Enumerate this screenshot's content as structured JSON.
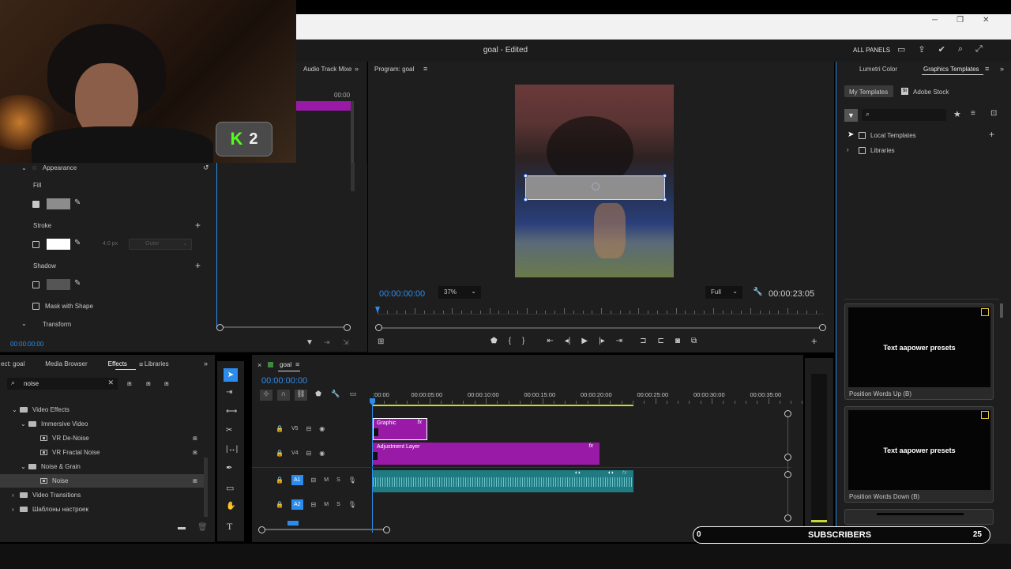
{
  "window": {
    "title": "goal - Edited",
    "all_panels": "ALL PANELS"
  },
  "overlay": {
    "kick_label": "2",
    "sub_left": "0",
    "sub_label": "SUBSCRIBERS",
    "sub_right": "25"
  },
  "effect_controls": {
    "audio_mixer_tab": "Audio Track Mixe",
    "mini_time": "00:00",
    "appearance": "Appearance",
    "fill": "Fill",
    "stroke": "Stroke",
    "stroke_size": "4.0",
    "stroke_unit": "px",
    "stroke_type": "Outer",
    "shadow": "Shadow",
    "mask": "Mask with Shape",
    "transform": "Transform",
    "timecode": "00:00:00:00"
  },
  "program": {
    "tab": "Program: goal",
    "timecode": "00:00:00:00",
    "zoom": "37%",
    "quality": "Full",
    "duration": "00:00:23:05"
  },
  "right_panel": {
    "tab_lumetri": "Lumetri Color",
    "tab_graphics": "Graphics Templates",
    "my_templates": "My Templates",
    "adobe_stock": "Adobe Stock",
    "tree": [
      "Local Templates",
      "Libraries"
    ],
    "templates": [
      {
        "preview": "Text aapower presets",
        "name": "Position Words Up (B)"
      },
      {
        "preview": "Text aapower presets",
        "name": "Position Words Down (B)"
      }
    ]
  },
  "effects_panel": {
    "tabs": [
      "ect: goal",
      "Media Browser",
      "Effects",
      "Libraries"
    ],
    "search_value": "noise",
    "tree": [
      {
        "label": "Video Effects",
        "level": 1,
        "kind": "folder",
        "open": true
      },
      {
        "label": "Immersive Video",
        "level": 2,
        "kind": "folder",
        "open": true
      },
      {
        "label": "VR De-Noise",
        "level": 3,
        "kind": "effect"
      },
      {
        "label": "VR Fractal Noise",
        "level": 3,
        "kind": "effect"
      },
      {
        "label": "Noise & Grain",
        "level": 2,
        "kind": "folder",
        "open": true
      },
      {
        "label": "Noise",
        "level": 3,
        "kind": "effect",
        "selected": true
      },
      {
        "label": "Video Transitions",
        "level": 1,
        "kind": "folder",
        "open": false
      },
      {
        "label": "Шаблоны настроек",
        "level": 1,
        "kind": "folder",
        "open": false
      }
    ]
  },
  "timeline": {
    "sequence": "goal",
    "timecode": "00:00:00:00",
    "ruler": [
      ":00:00",
      "00:00:05:00",
      "00:00:10:00",
      "00:00:15:00",
      "00:00:20:00",
      "00:00:25:00",
      "00:00:30:00",
      "00:00:35:00"
    ],
    "tracks": [
      {
        "id": "V5",
        "clip": "Graphic"
      },
      {
        "id": "V4",
        "clip": "Adjustment Layer"
      },
      {
        "id": "A1",
        "clip": ""
      },
      {
        "id": "A2",
        "clip": ""
      }
    ],
    "fx": "fx",
    "m": "M",
    "s": "S"
  },
  "colors": {
    "accent_blue": "#2d8ceb",
    "clip_purple": "#9a1aa8",
    "audio_teal": "#1f7a82"
  }
}
